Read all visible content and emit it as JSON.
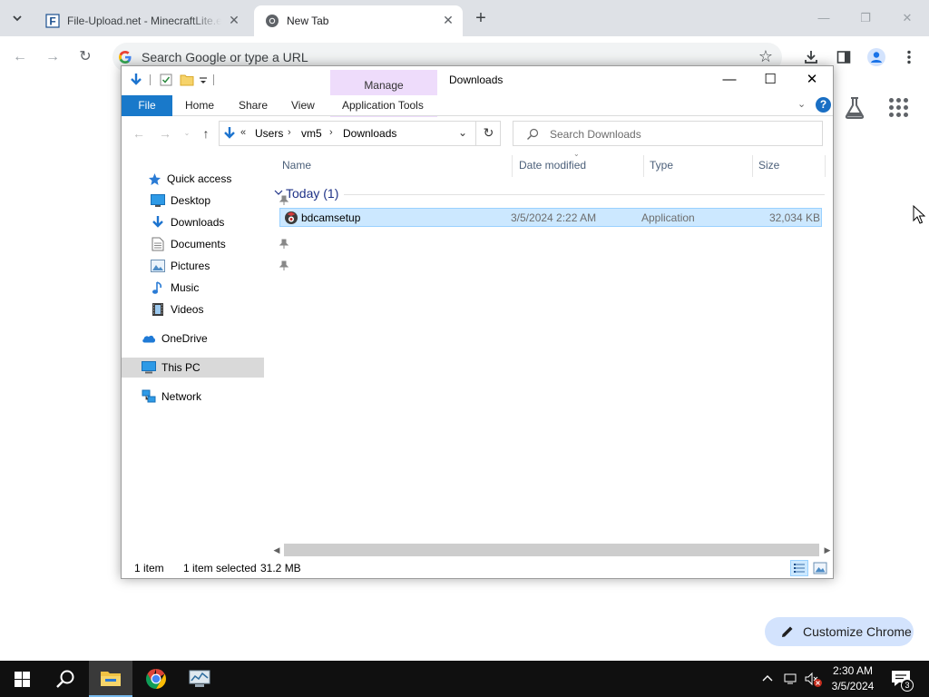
{
  "browser": {
    "tabs": [
      {
        "title": "File-Upload.net - MinecraftLite.exe",
        "favicon": "F"
      },
      {
        "title": "New Tab"
      }
    ],
    "omnibox_placeholder": "Search Google or type a URL",
    "customize_label": "Customize Chrome"
  },
  "explorer": {
    "window_title": "Downloads",
    "contextual_tab_group": "Manage",
    "ribbon_tabs": [
      "File",
      "Home",
      "Share",
      "View",
      "Application Tools"
    ],
    "breadcrumb": {
      "overflow": "«",
      "parts": [
        "Users",
        "vm5",
        "Downloads"
      ]
    },
    "search_placeholder": "Search Downloads",
    "nav_pane": [
      {
        "label": "Quick access",
        "icon": "star-icon"
      },
      {
        "label": "Desktop",
        "icon": "desktop-icon",
        "pinned": true
      },
      {
        "label": "Downloads",
        "icon": "download-arrow-icon",
        "pinned": true
      },
      {
        "label": "Documents",
        "icon": "documents-icon",
        "pinned": true
      },
      {
        "label": "Pictures",
        "icon": "pictures-icon",
        "pinned": true
      },
      {
        "label": "Music",
        "icon": "music-icon"
      },
      {
        "label": "Videos",
        "icon": "videos-icon"
      },
      {
        "label": "OneDrive",
        "icon": "cloud-icon"
      },
      {
        "label": "This PC",
        "icon": "computer-icon",
        "selected": true
      },
      {
        "label": "Network",
        "icon": "network-icon"
      }
    ],
    "columns": [
      "Name",
      "Date modified",
      "Type",
      "Size"
    ],
    "group_label": "Today (1)",
    "files": [
      {
        "name": "bdcamsetup",
        "date_modified": "3/5/2024 2:22 AM",
        "type": "Application",
        "size": "32,034 KB",
        "selected": true
      }
    ],
    "status": {
      "count": "1 item",
      "selection": "1 item selected",
      "size": "31.2 MB"
    }
  },
  "taskbar": {
    "time": "2:30 AM",
    "date": "3/5/2024",
    "notification_count": "3",
    "pinned": [
      "start-icon",
      "search-icon",
      "file-explorer-icon",
      "chrome-icon",
      "network-tool-icon"
    ]
  },
  "colors": {
    "accent": "#1979ca",
    "selection_bg": "#cce8ff",
    "manage_tab": "#eedcfb",
    "chrome_frame": "#dee1e6",
    "taskbar": "#101010"
  }
}
